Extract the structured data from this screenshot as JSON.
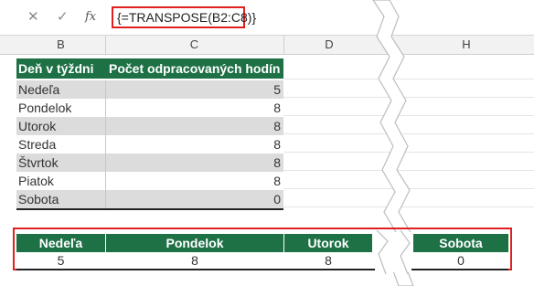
{
  "formula_bar": {
    "cancel_icon": "close-icon",
    "confirm_icon": "check-icon",
    "fx_label": "fx",
    "formula": "{=TRANSPOSE(B2:C8)}"
  },
  "columns": [
    "B",
    "C",
    "D",
    "H"
  ],
  "table": {
    "headers": [
      "Deň v týždni",
      "Počet odpracovaných hodín"
    ],
    "rows": [
      {
        "day": "Nedeľa",
        "hours": "5"
      },
      {
        "day": "Pondelok",
        "hours": "8"
      },
      {
        "day": "Utorok",
        "hours": "8"
      },
      {
        "day": "Streda",
        "hours": "8"
      },
      {
        "day": "Štvrtok",
        "hours": "8"
      },
      {
        "day": "Piatok",
        "hours": "8"
      },
      {
        "day": "Sobota",
        "hours": "0"
      }
    ]
  },
  "transposed": {
    "headers": [
      "Nedeľa",
      "Pondelok",
      "Utorok",
      "Sobota"
    ],
    "values": [
      "5",
      "8",
      "8",
      "0"
    ]
  },
  "colors": {
    "header_green": "#1e7145",
    "highlight_red": "#e02020",
    "row_shade": "#dcdcdc"
  }
}
